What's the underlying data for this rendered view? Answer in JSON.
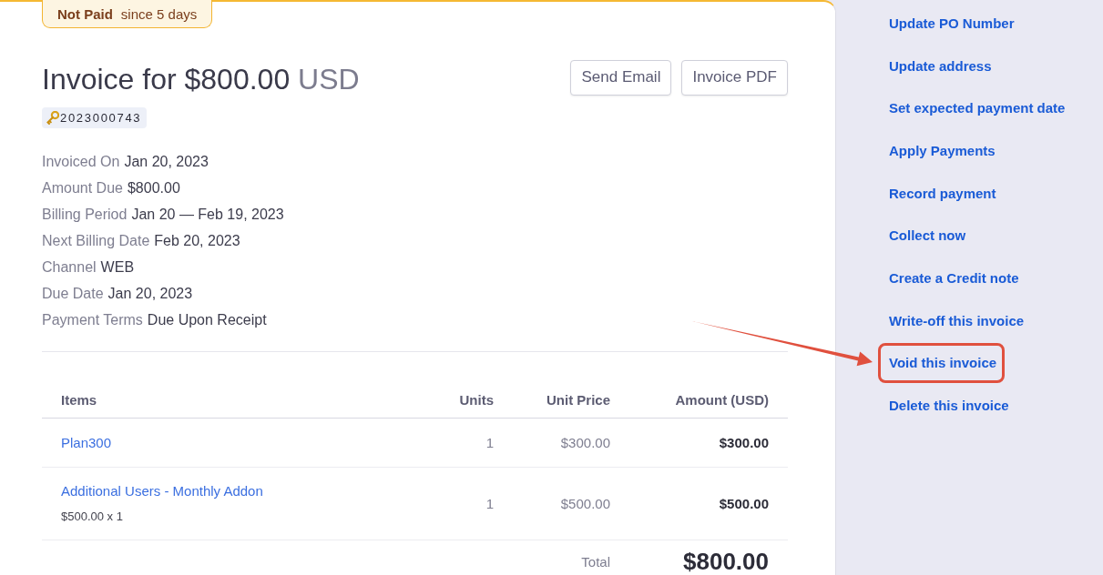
{
  "invoice": {
    "status_badge": {
      "status": "Not Paid",
      "since": "since 5 days"
    },
    "title": "Invoice for $800.00",
    "title_currency": "USD",
    "buttons": [
      "Send Email",
      "Invoice PDF"
    ],
    "invoice_number": "2023000743",
    "details": [
      {
        "label": "Invoiced On",
        "value": "Jan 20, 2023"
      },
      {
        "label": "Amount Due",
        "value": "$800.00"
      },
      {
        "label": "Billing Period",
        "value": "Jan 20 — Feb 19, 2023"
      },
      {
        "label": "Next Billing Date",
        "value": "Feb 20, 2023"
      },
      {
        "label": "Channel",
        "value": "WEB"
      },
      {
        "label": "Due Date",
        "value": "Jan 20, 2023"
      },
      {
        "label": "Payment Terms",
        "value": "Due Upon Receipt"
      }
    ]
  },
  "items_table": {
    "columns": [
      "Items",
      "Units",
      "Unit Price",
      "Amount (USD)"
    ],
    "rows": [
      {
        "item": "Plan300",
        "units": "1",
        "unit_price": "$300.00",
        "amount": "$300.00"
      },
      {
        "item": "Additional Users - Monthly Addon",
        "note": "$500.00 x 1",
        "units": "1",
        "unit_price": "$500.00",
        "amount": "$500.00"
      }
    ],
    "total_label": "Total",
    "total": "$800.00"
  },
  "actions": [
    {
      "label": "Update PO Number",
      "highlighted": false
    },
    {
      "label": "Update address",
      "highlighted": false
    },
    {
      "label": "Set expected payment date",
      "highlighted": false
    },
    {
      "label": "Apply Payments",
      "highlighted": false
    },
    {
      "label": "Record payment",
      "highlighted": false
    },
    {
      "label": "Collect now",
      "highlighted": false
    },
    {
      "label": "Create a Credit note",
      "highlighted": false
    },
    {
      "label": "Write-off this invoice",
      "highlighted": false
    },
    {
      "label": "Void this invoice",
      "highlighted": true
    },
    {
      "label": "Delete this invoice",
      "highlighted": false
    }
  ]
}
